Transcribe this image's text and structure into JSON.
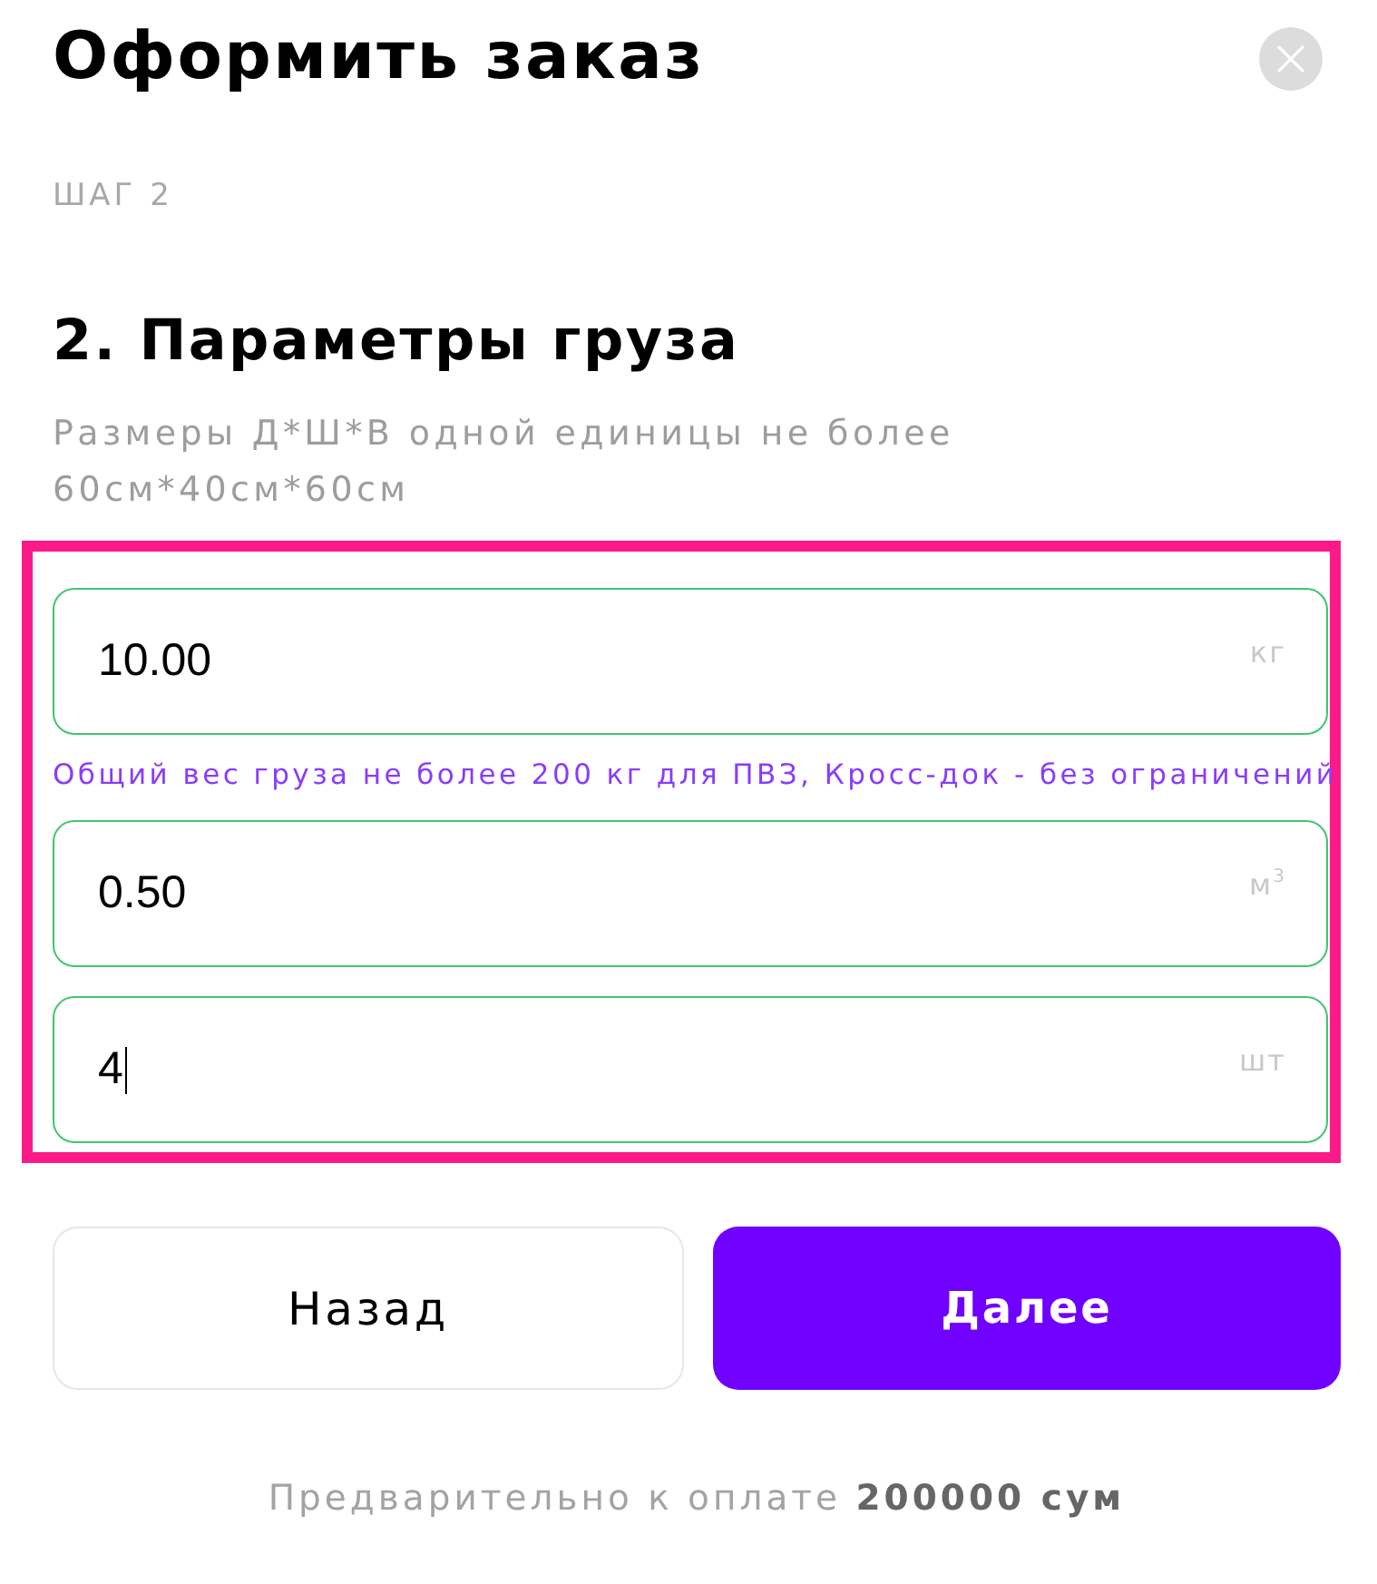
{
  "dialog": {
    "title": "Оформить заказ",
    "step": "ШАГ 2"
  },
  "section": {
    "heading": "2. Параметры груза",
    "note": "Размеры Д*Ш*В одной единицы не более 60см*40см*60см"
  },
  "cargo_form": {
    "highlighted": true,
    "fields": [
      {
        "value": "10.00",
        "unit": "кг",
        "focused": false,
        "hint": "Общий вес груза не более 200 кг для ПВЗ, Кросс-док - без ограничений"
      },
      {
        "value": "0.50",
        "unit": "м$^{3}$",
        "focused": false
      },
      {
        "value": "4",
        "unit": "шт",
        "focused": true
      }
    ]
  },
  "buttons": [
    {
      "label": "Назад",
      "kind": "secondary"
    },
    {
      "label": "Далее",
      "kind": "primary"
    }
  ],
  "footer": "Предварительно к оплате **200000 сум**"
}
